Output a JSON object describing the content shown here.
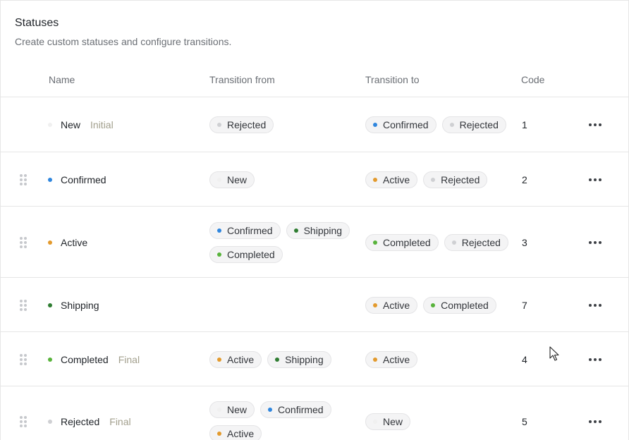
{
  "header": {
    "title": "Statuses",
    "subtitle": "Create custom statuses and configure transitions."
  },
  "columns": {
    "name": "Name",
    "from": "Transition from",
    "to": "Transition to",
    "code": "Code"
  },
  "colors": {
    "New": "#f0f0f0",
    "Confirmed": "#2f86de",
    "Active": "#e39a2d",
    "Shipping": "#2f7d32",
    "Completed": "#58b33b",
    "Rejected": "#cfd0d3"
  },
  "rows": [
    {
      "name": "New",
      "tag": "Initial",
      "from": [
        "Rejected"
      ],
      "to": [
        "Confirmed",
        "Rejected"
      ],
      "code": "1",
      "draggable": false
    },
    {
      "name": "Confirmed",
      "tag": "",
      "from": [
        "New"
      ],
      "to": [
        "Active",
        "Rejected"
      ],
      "code": "2",
      "draggable": true
    },
    {
      "name": "Active",
      "tag": "",
      "from": [
        "Confirmed",
        "Shipping",
        "Completed"
      ],
      "to": [
        "Completed",
        "Rejected"
      ],
      "code": "3",
      "draggable": true
    },
    {
      "name": "Shipping",
      "tag": "",
      "from": [],
      "to": [
        "Active",
        "Completed"
      ],
      "code": "7",
      "draggable": true
    },
    {
      "name": "Completed",
      "tag": "Final",
      "from": [
        "Active",
        "Shipping"
      ],
      "to": [
        "Active"
      ],
      "code": "4",
      "draggable": true
    },
    {
      "name": "Rejected",
      "tag": "Final",
      "from": [
        "New",
        "Confirmed",
        "Active"
      ],
      "to": [
        "New"
      ],
      "code": "5",
      "draggable": true
    }
  ]
}
